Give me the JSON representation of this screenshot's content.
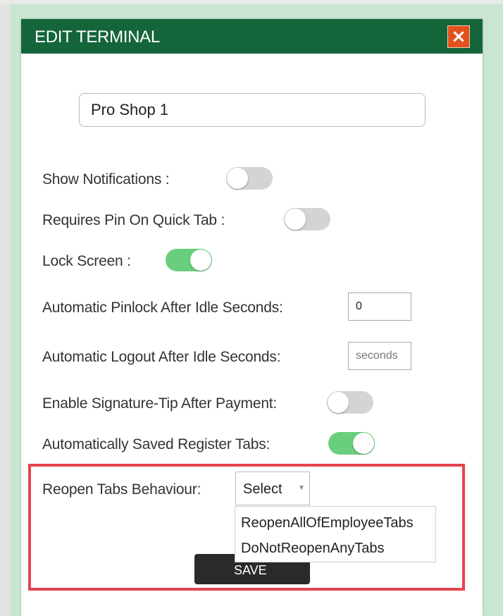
{
  "dialog": {
    "title": "EDIT TERMINAL",
    "close_label": "×"
  },
  "terminal_name": {
    "value": "Pro Shop 1"
  },
  "settings": {
    "show_notifications": {
      "label": "Show Notifications :",
      "enabled": false
    },
    "requires_pin_quick_tab": {
      "label": "Requires Pin On Quick Tab :",
      "enabled": false
    },
    "lock_screen": {
      "label": "Lock Screen :",
      "enabled": true
    },
    "pinlock_idle": {
      "label": "Automatic Pinlock After Idle Seconds:",
      "value": "0"
    },
    "logout_idle": {
      "label": "Automatic Logout After Idle Seconds:",
      "value": "",
      "placeholder": "seconds"
    },
    "signature_tip": {
      "label": "Enable Signature-Tip After Payment:",
      "enabled": false
    },
    "auto_saved_tabs": {
      "label": "Automatically Saved Register Tabs:",
      "enabled": true
    },
    "reopen_tabs": {
      "label": "Reopen Tabs Behaviour:",
      "selected": "Select",
      "options": [
        "ReopenAllOfEmployeeTabs",
        "DoNotReopenAnyTabs"
      ]
    }
  },
  "save_button": {
    "label": "SAVE"
  },
  "colors": {
    "titlebar": "#14653a",
    "close_button": "#e2521d",
    "toggle_on": "#69cf7c",
    "toggle_off": "#d4d4d4",
    "highlight_border": "#e7444e",
    "save_button": "#2c2a28"
  }
}
